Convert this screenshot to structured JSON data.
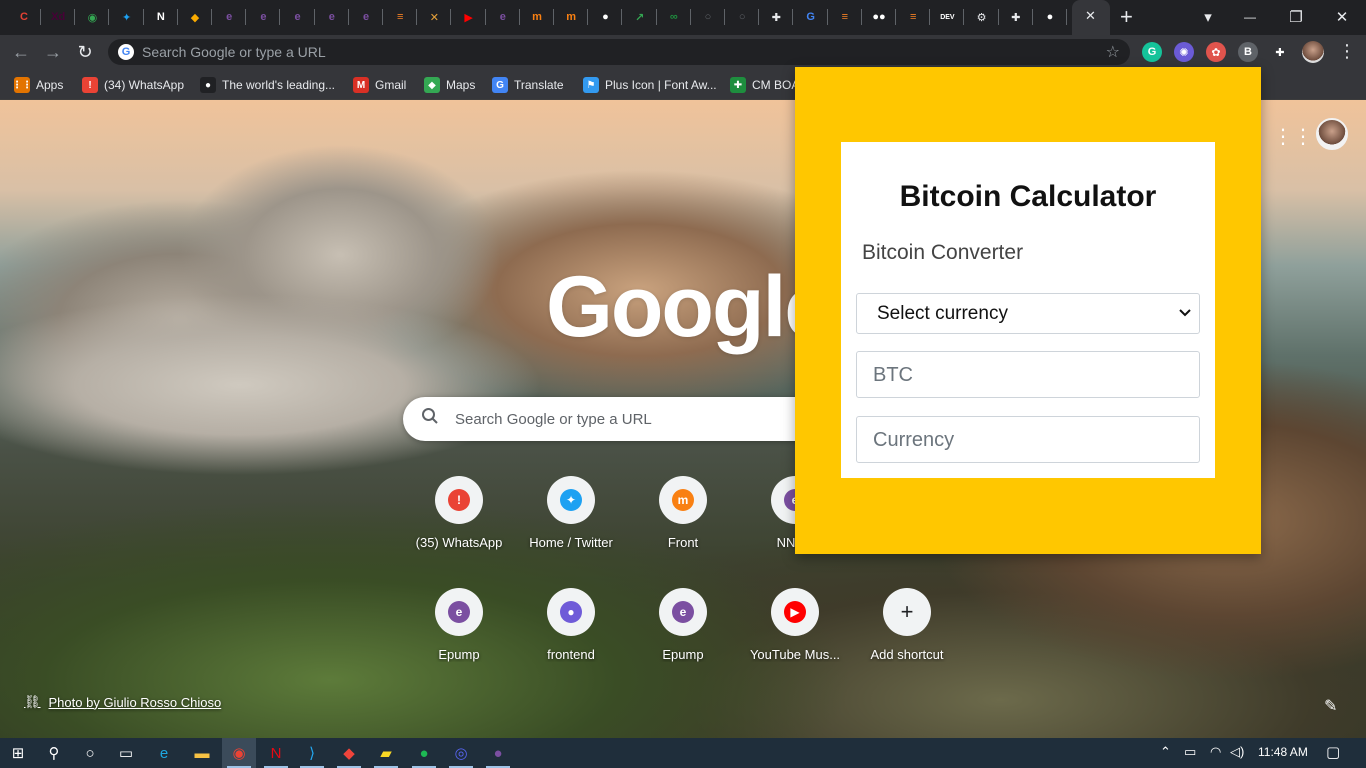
{
  "window": {
    "tabs": [
      {
        "icon": "chrome-tab-icon",
        "color": "#e34133",
        "glyph": "C"
      },
      {
        "icon": "xd-tab-icon",
        "color": "#470137",
        "glyph": "Xd"
      },
      {
        "icon": "green-circle-tab-icon",
        "color": "#34a853",
        "glyph": "◉"
      },
      {
        "icon": "twitter-tab-icon",
        "color": "#1da1f2",
        "glyph": "✦"
      },
      {
        "icon": "notion-tab-icon",
        "color": "#ffffff",
        "glyph": "N"
      },
      {
        "icon": "layers-tab-icon",
        "color": "#f9ab00",
        "glyph": "◆"
      },
      {
        "icon": "epump-tab-icon",
        "color": "#7b4fa1",
        "glyph": "e"
      },
      {
        "icon": "epump-tab-icon",
        "color": "#7b4fa1",
        "glyph": "e"
      },
      {
        "icon": "epump-tab-icon",
        "color": "#7b4fa1",
        "glyph": "e"
      },
      {
        "icon": "epump-tab-icon",
        "color": "#7b4fa1",
        "glyph": "e"
      },
      {
        "icon": "epump-tab-icon",
        "color": "#7b4fa1",
        "glyph": "e"
      },
      {
        "icon": "stackoverflow-tab-icon",
        "color": "#f48024",
        "glyph": "≡"
      },
      {
        "icon": "tools-tab-icon",
        "color": "#e8a33a",
        "glyph": "✕"
      },
      {
        "icon": "youtube-music-tab-icon",
        "color": "#ff0000",
        "glyph": "▶"
      },
      {
        "icon": "epump-tab-icon",
        "color": "#7b4fa1",
        "glyph": "e"
      },
      {
        "icon": "moodle-tab-icon",
        "color": "#f98012",
        "glyph": "m"
      },
      {
        "icon": "moodle-tab-icon",
        "color": "#f98012",
        "glyph": "m"
      },
      {
        "icon": "github-tab-icon",
        "color": "#ffffff",
        "glyph": "●"
      },
      {
        "icon": "chart-tab-icon",
        "color": "#34a853",
        "glyph": "↗"
      },
      {
        "icon": "link-tab-icon",
        "color": "#1e8e3e",
        "glyph": "∞"
      },
      {
        "icon": "globe-tab-icon",
        "color": "#5f6368",
        "glyph": "○"
      },
      {
        "icon": "globe-tab-icon",
        "color": "#5f6368",
        "glyph": "○"
      },
      {
        "icon": "puzzle-tab-icon",
        "color": "#e8eaed",
        "glyph": "✚"
      },
      {
        "icon": "google-tab-icon",
        "color": "#4285f4",
        "glyph": "G"
      },
      {
        "icon": "stackoverflow-tab-icon",
        "color": "#f48024",
        "glyph": "≡"
      },
      {
        "icon": "medium-tab-icon",
        "color": "#ffffff",
        "glyph": "●●"
      },
      {
        "icon": "stackoverflow-tab-icon",
        "color": "#f48024",
        "glyph": "≡"
      },
      {
        "icon": "dev-tab-icon",
        "color": "#ffffff",
        "glyph": "DEV"
      },
      {
        "icon": "gear-tab-icon",
        "color": "#e8eaed",
        "glyph": "⚙"
      },
      {
        "icon": "puzzle-tab-icon",
        "color": "#e8eaed",
        "glyph": "✚"
      },
      {
        "icon": "github-tab-icon",
        "color": "#ffffff",
        "glyph": "●"
      }
    ],
    "close_tab": "✕",
    "new_tab": "+",
    "controls": {
      "menu": "▾",
      "minimize": "—",
      "maximize": "❐",
      "close": "✕"
    }
  },
  "toolbar": {
    "back": "←",
    "forward": "→",
    "reload": "↻",
    "omnibox_placeholder": "Search Google or type a URL",
    "star": "☆",
    "extensions": [
      {
        "name": "grammarly-icon",
        "color": "#15c39a",
        "glyph": "G"
      },
      {
        "name": "sparkle-extension-icon",
        "color": "#6b5bd6",
        "glyph": "✺"
      },
      {
        "name": "color-extension-icon",
        "color": "#e0544d",
        "glyph": "✿"
      },
      {
        "name": "bitcoin-extension-icon",
        "color": "#5f6368",
        "glyph": "B"
      },
      {
        "name": "puzzle-icon",
        "color": "#35363a",
        "glyph": "✚"
      }
    ],
    "menu": "⋮"
  },
  "bookmarks": [
    {
      "label": "Apps",
      "icon": "apps-grid-icon",
      "color": "#e37400",
      "glyph": "⋮⋮"
    },
    {
      "label": "(34) WhatsApp",
      "icon": "whatsapp-icon",
      "color": "#ea4335",
      "glyph": "!"
    },
    {
      "label": "The world's leading...",
      "icon": "github-icon",
      "color": "#202124",
      "glyph": "●"
    },
    {
      "label": "Gmail",
      "icon": "gmail-icon",
      "color": "#d93025",
      "glyph": "M"
    },
    {
      "label": "Maps",
      "icon": "maps-icon",
      "color": "#34a853",
      "glyph": "◆"
    },
    {
      "label": "Translate",
      "icon": "translate-icon",
      "color": "#4285f4",
      "glyph": "G"
    },
    {
      "label": "Plus Icon | Font Aw...",
      "icon": "font-awesome-icon",
      "color": "#339af0",
      "glyph": "⚑"
    },
    {
      "label": "CM BOA",
      "icon": "cm-board-icon",
      "color": "#1e8e3e",
      "glyph": "✚"
    }
  ],
  "ntp": {
    "logo": "Google",
    "search_placeholder": "Search Google or type a URL",
    "shortcuts": [
      {
        "label": "(35) WhatsApp",
        "icon": "whatsapp-shortcut-icon",
        "bg": "#ea4335",
        "glyph": "!"
      },
      {
        "label": "Home / Twitter",
        "icon": "twitter-shortcut-icon",
        "bg": "#1da1f2",
        "glyph": "✦"
      },
      {
        "label": "Front",
        "icon": "moodle-shortcut-icon",
        "bg": "#f98012",
        "glyph": "m"
      },
      {
        "label": "NNPC",
        "icon": "epump-shortcut-icon",
        "bg": "#7b4fa1",
        "glyph": "e"
      },
      {
        "label": "Epump",
        "icon": "epump-shortcut-icon",
        "bg": "#7b4fa1",
        "glyph": "e"
      },
      {
        "label": "frontend",
        "icon": "frontend-shortcut-icon",
        "bg": "#6f5bd8",
        "glyph": "●"
      },
      {
        "label": "Epump",
        "icon": "epump-shortcut-icon",
        "bg": "#7b4fa1",
        "glyph": "e"
      },
      {
        "label": "YouTube Mus...",
        "icon": "youtube-music-shortcut-icon",
        "bg": "#ff0000",
        "glyph": "▶"
      },
      {
        "label": "Add shortcut",
        "icon": "plus-icon",
        "bg": "#f1f3f4",
        "glyph": "+"
      }
    ],
    "photo_credit": "Photo by Giulio Rosso Chioso",
    "apps_icon": "⋮⋮⋮",
    "edit_icon": "✎"
  },
  "popup": {
    "title": "Bitcoin Calculator",
    "subtitle": "Bitcoin Converter",
    "select_label": "Select currency",
    "btc_placeholder": "BTC",
    "currency_placeholder": "Currency",
    "caret": "⌄"
  },
  "taskbar": {
    "time": "11:48 AM",
    "items": [
      {
        "name": "windows-start-icon",
        "glyph": "⊞",
        "color": "#ffffff"
      },
      {
        "name": "search-icon",
        "glyph": "⚲",
        "color": "#ffffff"
      },
      {
        "name": "cortana-icon",
        "glyph": "○",
        "color": "#ffffff"
      },
      {
        "name": "task-view-icon",
        "glyph": "▭",
        "color": "#ffffff"
      },
      {
        "name": "edge-icon",
        "glyph": "e",
        "color": "#1ea7e1"
      },
      {
        "name": "file-explorer-icon",
        "glyph": "▬",
        "color": "#f7c244"
      },
      {
        "name": "chrome-icon",
        "glyph": "◉",
        "color": "#ea4335"
      },
      {
        "name": "netflix-icon",
        "glyph": "N",
        "color": "#e50914"
      },
      {
        "name": "vscode-icon",
        "glyph": "⟩",
        "color": "#23a9f2"
      },
      {
        "name": "anydesk-icon",
        "glyph": "◆",
        "color": "#ef443b"
      },
      {
        "name": "sticky-notes-icon",
        "glyph": "▰",
        "color": "#f8d825"
      },
      {
        "name": "spotify-icon",
        "glyph": "●",
        "color": "#1db954"
      },
      {
        "name": "discord-icon",
        "glyph": "◎",
        "color": "#5865f2"
      },
      {
        "name": "github-desktop-icon",
        "glyph": "●",
        "color": "#7b4fa1"
      }
    ],
    "tray": {
      "chevron": "⌃",
      "battery": "▭",
      "wifi": "◠",
      "volume": "◁)",
      "notifications": "▢"
    }
  }
}
